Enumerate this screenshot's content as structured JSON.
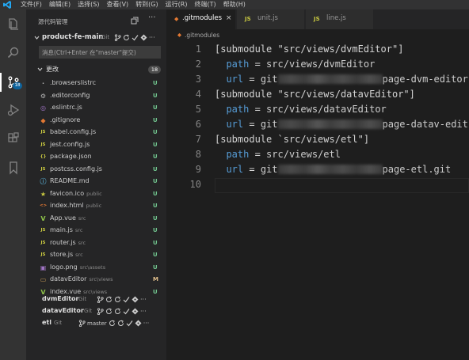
{
  "menu": [
    "文件(F)",
    "编辑(E)",
    "选择(S)",
    "查看(V)",
    "转到(G)",
    "运行(R)",
    "终端(T)",
    "帮助(H)"
  ],
  "activity": {
    "scm_badge": "18"
  },
  "sidebar": {
    "title": "源代码管理",
    "main_repo": {
      "name": "product-fe-main",
      "kind": "Git"
    },
    "commit_placeholder": "消息(Ctrl+Enter 在\"master\"提交)",
    "changes": {
      "label": "更改",
      "count": "18"
    },
    "files": [
      {
        "name": ".browserslistrc",
        "dir": "",
        "status": "U",
        "icon": "dot-icon"
      },
      {
        "name": ".editorconfig",
        "dir": "",
        "status": "U",
        "icon": "gear-icon"
      },
      {
        "name": ".eslintrc.js",
        "dir": "",
        "status": "U",
        "icon": "eslint-icon"
      },
      {
        "name": ".gitignore",
        "dir": "",
        "status": "U",
        "icon": "git-icon"
      },
      {
        "name": "babel.config.js",
        "dir": "",
        "status": "U",
        "icon": "js-icon"
      },
      {
        "name": "jest.config.js",
        "dir": "",
        "status": "U",
        "icon": "js-icon"
      },
      {
        "name": "package.json",
        "dir": "",
        "status": "U",
        "icon": "json-icon"
      },
      {
        "name": "postcss.config.js",
        "dir": "",
        "status": "U",
        "icon": "js-icon"
      },
      {
        "name": "README.md",
        "dir": "",
        "status": "U",
        "icon": "info-icon"
      },
      {
        "name": "favicon.ico",
        "dir": "public",
        "status": "U",
        "icon": "star-icon"
      },
      {
        "name": "index.html",
        "dir": "public",
        "status": "U",
        "icon": "html-icon"
      },
      {
        "name": "App.vue",
        "dir": "src",
        "status": "U",
        "icon": "vue-icon"
      },
      {
        "name": "main.js",
        "dir": "src",
        "status": "U",
        "icon": "js-icon"
      },
      {
        "name": "router.js",
        "dir": "src",
        "status": "U",
        "icon": "js-icon"
      },
      {
        "name": "store.js",
        "dir": "src",
        "status": "U",
        "icon": "js-icon"
      },
      {
        "name": "logo.png",
        "dir": "src\\assets",
        "status": "U",
        "icon": "image-icon"
      },
      {
        "name": "datavEditor",
        "dir": "src\\views",
        "status": "M",
        "icon": "folder-icon"
      },
      {
        "name": "index.vue",
        "dir": "src\\views",
        "status": "U",
        "icon": "vue-icon"
      }
    ],
    "sub_repos": [
      {
        "name": "dvmEditor",
        "kind": "Git",
        "branch": ""
      },
      {
        "name": "datavEditor",
        "kind": "Git",
        "branch": ""
      },
      {
        "name": "etl",
        "kind": "Git",
        "branch": "master"
      }
    ]
  },
  "tabs": [
    {
      "label": ".gitmodules",
      "icon_text": "◆",
      "active": true,
      "close": "×"
    },
    {
      "label": "unit.js",
      "icon_text": "JS",
      "active": false
    },
    {
      "label": "line.js",
      "icon_text": "JS",
      "active": false
    }
  ],
  "breadcrumb": ".gitmodules",
  "editor": {
    "lines": [
      {
        "n": "1",
        "type": "section",
        "text": "[submodule \"src/views/dvmEditor\"]"
      },
      {
        "n": "2",
        "type": "kv",
        "key": "path",
        "eq": " = ",
        "val": "src/views/dvmEditor"
      },
      {
        "n": "3",
        "type": "url",
        "key": "url",
        "eq": " = ",
        "pre": "git",
        "post": "page-dvm-editor"
      },
      {
        "n": "4",
        "type": "section",
        "text": "[submodule \"src/views/datavEditor\"]"
      },
      {
        "n": "5",
        "type": "kv",
        "key": "path",
        "eq": " = ",
        "val": "src/views/datavEditor"
      },
      {
        "n": "6",
        "type": "url",
        "key": "url",
        "eq": " = ",
        "pre": "git",
        "post": "page-datav-edit"
      },
      {
        "n": "7",
        "type": "section",
        "text": "[submodule `src/views/etl\"]"
      },
      {
        "n": "8",
        "type": "kv",
        "key": "path",
        "eq": " = ",
        "val": "src/views/etl"
      },
      {
        "n": "9",
        "type": "url",
        "key": "url",
        "eq": " = ",
        "pre": "git",
        "post": "page-etl.git"
      },
      {
        "n": "10",
        "type": "blank"
      }
    ]
  },
  "colors": {
    "untracked": "#73c991",
    "modified": "#e2c08d",
    "accent": "#0e639c",
    "key": "#569cd6"
  }
}
